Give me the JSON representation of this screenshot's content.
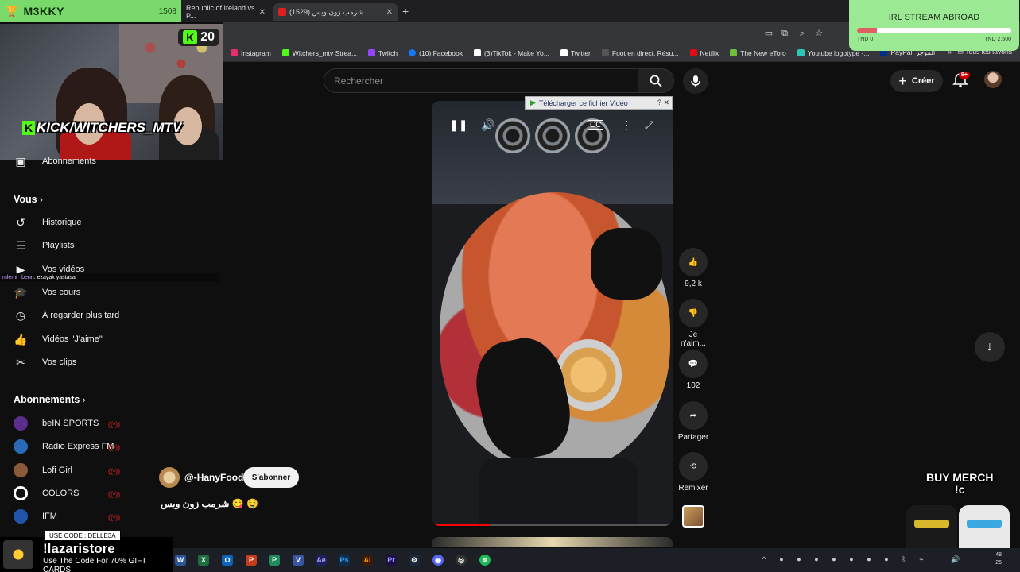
{
  "overlay": {
    "streamer_name": "M3KKY",
    "points": "1508",
    "kick_viewers": "20",
    "kick_channel": "KICK/WITCHERS_MTV",
    "kick_letter": "K",
    "trophy_icon": "trophy-icon"
  },
  "tabs": [
    {
      "label": "Republic of Ireland vs P..."
    },
    {
      "label": "شرمب زون ويس (1529)"
    }
  ],
  "bookmarks": [
    {
      "label": "Instagram",
      "color": "#e1306c"
    },
    {
      "label": "Witchers_mtv Strea...",
      "color": "#53fc18"
    },
    {
      "label": "Twitch",
      "color": "#9146ff"
    },
    {
      "label": "(10) Facebook",
      "color": "#1877f2"
    },
    {
      "label": "(3)TikTok - Make Yo...",
      "color": "#ffffff"
    },
    {
      "label": "Twitter",
      "color": "#ffffff"
    },
    {
      "label": "Foot en direct, Résu...",
      "color": "#333333"
    },
    {
      "label": "Netflix",
      "color": "#e50914"
    },
    {
      "label": "The New eToro",
      "color": "#6cbf3a"
    },
    {
      "label": "Youtube logotype -...",
      "color": "#2ec4b6"
    },
    {
      "label": "PayPal: الموجز",
      "color": "#003087"
    }
  ],
  "bookmarks_all": "Tous les favoris",
  "youtube": {
    "search_placeholder": "Rechercher",
    "create_label": "Créer",
    "notif_badge": "9+"
  },
  "sidebar": {
    "subscriptions_top": "Abonnements",
    "you_header": "Vous",
    "you_items": [
      {
        "label": "Historique",
        "icon": "history-icon"
      },
      {
        "label": "Playlists",
        "icon": "playlists-icon"
      },
      {
        "label": "Vos vidéos",
        "icon": "your-videos-icon"
      },
      {
        "label": "Vos cours",
        "icon": "courses-icon"
      },
      {
        "label": "À regarder plus tard",
        "icon": "watch-later-icon"
      },
      {
        "label": "Vidéos \"J'aime\"",
        "icon": "liked-icon"
      },
      {
        "label": "Vos clips",
        "icon": "clips-icon"
      }
    ],
    "subs_header": "Abonnements",
    "channels": [
      {
        "label": "beIN SPORTS",
        "color": "#5b2d8e"
      },
      {
        "label": "Radio Express FM",
        "color": "#2a6bb8"
      },
      {
        "label": "Lofi Girl",
        "color": "#8a5a3a"
      },
      {
        "label": "COLORS",
        "color": "#111111"
      },
      {
        "label": "IFM",
        "color": "#2255aa"
      }
    ]
  },
  "chat": {
    "user": "mlemi_jbenn",
    "message": ": ezayak yastasa"
  },
  "video": {
    "download_banner": "Télécharger ce fichier Vidéo",
    "progress": 0.24
  },
  "actions": {
    "likes": "9,2 k",
    "dislike": "Je n'aim...",
    "comments": "102",
    "share": "Partager",
    "remix": "Remixer"
  },
  "channel": {
    "handle": "@-HanyFood",
    "subscribe": "S'abonner",
    "title": "شرمب زون ويس 😋 🤤"
  },
  "abroad": {
    "title": "IRL STREAM ABROAD",
    "low": "TND 0",
    "high": "TND 2,500",
    "progress": 0.13
  },
  "merch": {
    "title": "BUY MERCH",
    "sub": "!c"
  },
  "promo": {
    "badge": "USE CODE : DELLE3A",
    "command": "!lazaristore",
    "sub": "Use The Code For 70% GIFT CARDS"
  },
  "taskbar": {
    "apps": [
      {
        "label": "W",
        "color": "#2b579a"
      },
      {
        "label": "X",
        "color": "#1d6f42"
      },
      {
        "label": "O",
        "color": "#0a64b7"
      },
      {
        "label": "P",
        "color": "#c43e1c"
      },
      {
        "label": "P",
        "color": "#1f8a5b"
      },
      {
        "label": "V",
        "color": "#3955a3"
      },
      {
        "label": "Ae",
        "color": "#1f1f5c"
      },
      {
        "label": "Ps",
        "color": "#0d2d4e"
      },
      {
        "label": "Ai",
        "color": "#3a1a08"
      },
      {
        "label": "Pr",
        "color": "#1e1046"
      }
    ],
    "clock_time": "48",
    "clock_date": "25"
  }
}
